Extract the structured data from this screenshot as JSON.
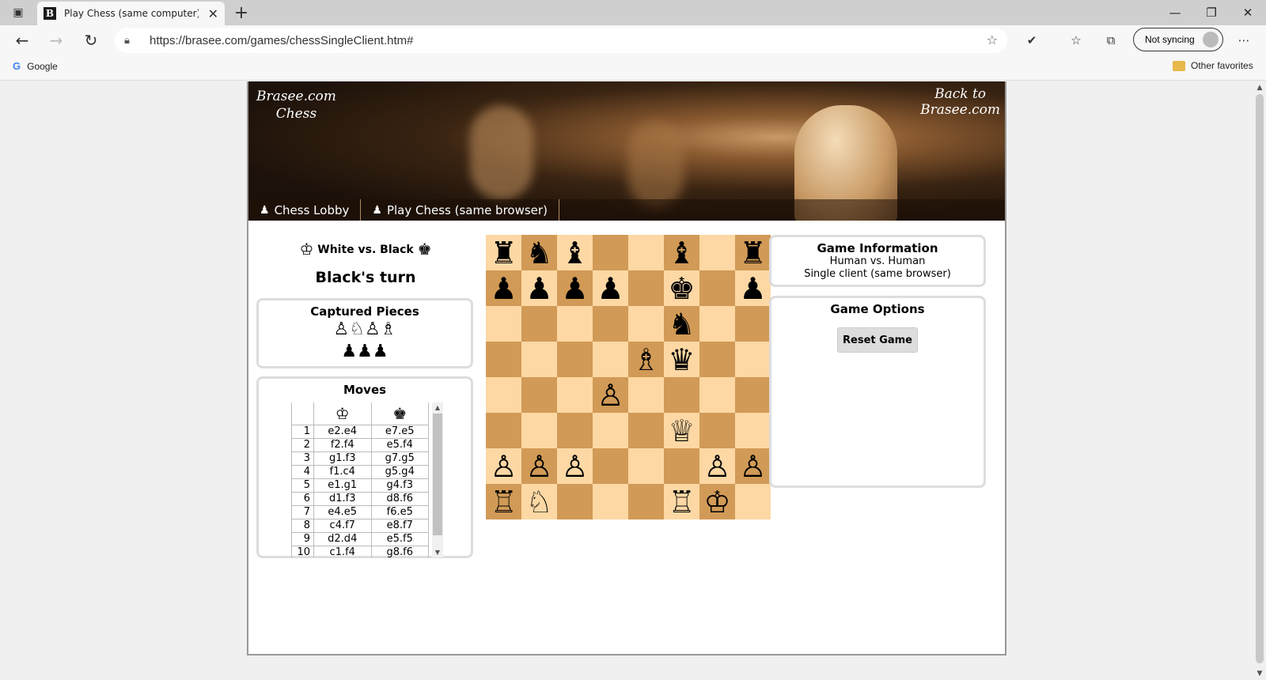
{
  "browser": {
    "tab_title": "Play Chess (same computer) - Br",
    "url": "https://brasee.com/games/chessSingleClient.htm#",
    "sync_label": "Not syncing",
    "bookmarks": {
      "google": "Google",
      "other": "Other favorites"
    }
  },
  "site": {
    "logo_line1": "Brasee.com",
    "logo_line2": "Chess",
    "back_line1": "Back to",
    "back_line2": "Brasee.com",
    "nav": [
      "Chess Lobby",
      "Play Chess (same browser)"
    ]
  },
  "game": {
    "players": "White vs. Black",
    "turn": "Black's turn",
    "captured_title": "Captured Pieces",
    "captured_white": "♙♘♙♗",
    "captured_black": "♟♟♟",
    "moves_title": "Moves",
    "moves": [
      [
        "1",
        "e2.e4",
        "e7.e5"
      ],
      [
        "2",
        "f2.f4",
        "e5.f4"
      ],
      [
        "3",
        "g1.f3",
        "g7.g5"
      ],
      [
        "4",
        "f1.c4",
        "g5.g4"
      ],
      [
        "5",
        "e1.g1",
        "g4.f3"
      ],
      [
        "6",
        "d1.f3",
        "d8.f6"
      ],
      [
        "7",
        "e4.e5",
        "f6.e5"
      ],
      [
        "8",
        "c4.f7",
        "e8.f7"
      ],
      [
        "9",
        "d2.d4",
        "e5.f5"
      ],
      [
        "10",
        "c1.f4",
        "g8.f6"
      ]
    ],
    "board": [
      "r n b . . b . r",
      "p p p p . k . p",
      ". . . . . n . .",
      ". . . . B q . .",
      ". . . P . . . .",
      ". . . . . Q . .",
      "P P P . . . P P",
      "R N . . . R K ."
    ]
  },
  "info": {
    "title": "Game Information",
    "line1": "Human vs. Human",
    "line2": "Single client (same browser)"
  },
  "options": {
    "title": "Game Options",
    "reset_label": "Reset Game"
  }
}
